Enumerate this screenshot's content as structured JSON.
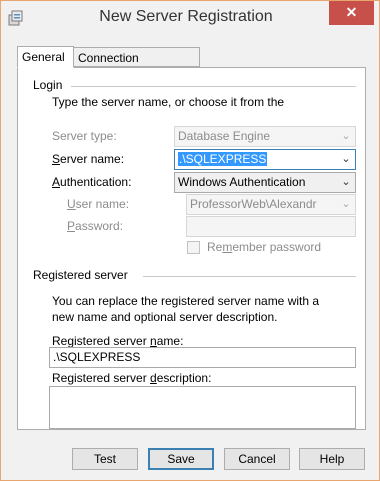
{
  "window": {
    "title": "New Server Registration",
    "close_glyph": "✕"
  },
  "tabs": [
    {
      "label": "General",
      "active": true
    },
    {
      "label": "Connection Properties",
      "active": false
    }
  ],
  "login": {
    "section_title": "Login",
    "instruction": "Type the server name, or choose it from the",
    "server_type": {
      "label": "Server type:",
      "value": "Database Engine"
    },
    "server_name": {
      "label_accel": "S",
      "label_rest": "erver name:",
      "value": ".\\SQLEXPRESS"
    },
    "authentication": {
      "label_accel": "A",
      "label_rest": "uthentication:",
      "value": "Windows Authentication"
    },
    "user_name": {
      "label_accel": "U",
      "label_rest": "ser name:",
      "value": "ProfessorWeb\\Alexandr"
    },
    "password": {
      "label_accel": "P",
      "label_rest": "assword:",
      "value": ""
    },
    "remember_password": {
      "label_pre": "Re",
      "label_accel": "m",
      "label_rest": "ember password",
      "checked": false
    }
  },
  "registered": {
    "section_title": "Registered server",
    "description_line1": "You can replace the registered server name with a",
    "description_line2": "new name and optional server description.",
    "name_label_pre": "Registered server ",
    "name_label_accel": "n",
    "name_label_rest": "ame:",
    "name_value": ".\\SQLEXPRESS",
    "desc_label_pre": "Registered server ",
    "desc_label_accel": "d",
    "desc_label_rest": "escription:",
    "desc_value": ""
  },
  "buttons": {
    "test": "Test",
    "save": "Save",
    "cancel": "Cancel",
    "help": "Help"
  },
  "icons": {
    "app": "server-registration-icon",
    "combo_arrow": "⌄"
  }
}
